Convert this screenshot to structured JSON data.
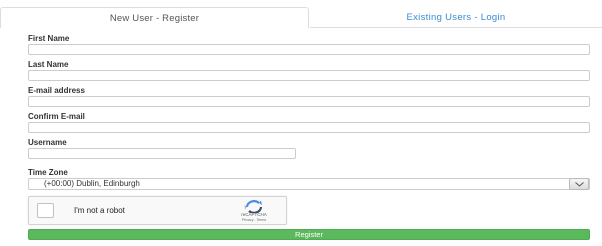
{
  "tabs": {
    "register": "New User - Register",
    "login": "Existing Users - Login"
  },
  "form": {
    "first_name_label": "First Name",
    "first_name_value": "",
    "last_name_label": "Last Name",
    "last_name_value": "",
    "email_label": "E-mail address",
    "email_value": "",
    "confirm_email_label": "Confirm E-mail",
    "confirm_email_value": "",
    "username_label": "Username",
    "username_value": "",
    "timezone_label": "Time Zone",
    "timezone_value": "(+00:00) Dublin, Edinburgh"
  },
  "captcha": {
    "label": "I'm not a robot",
    "brand": "reCAPTCHA",
    "links": "Privacy - Terms",
    "checked": false
  },
  "register_button": "Register",
  "colors": {
    "link": "#3a8ad4",
    "button": "#5cb85c"
  }
}
